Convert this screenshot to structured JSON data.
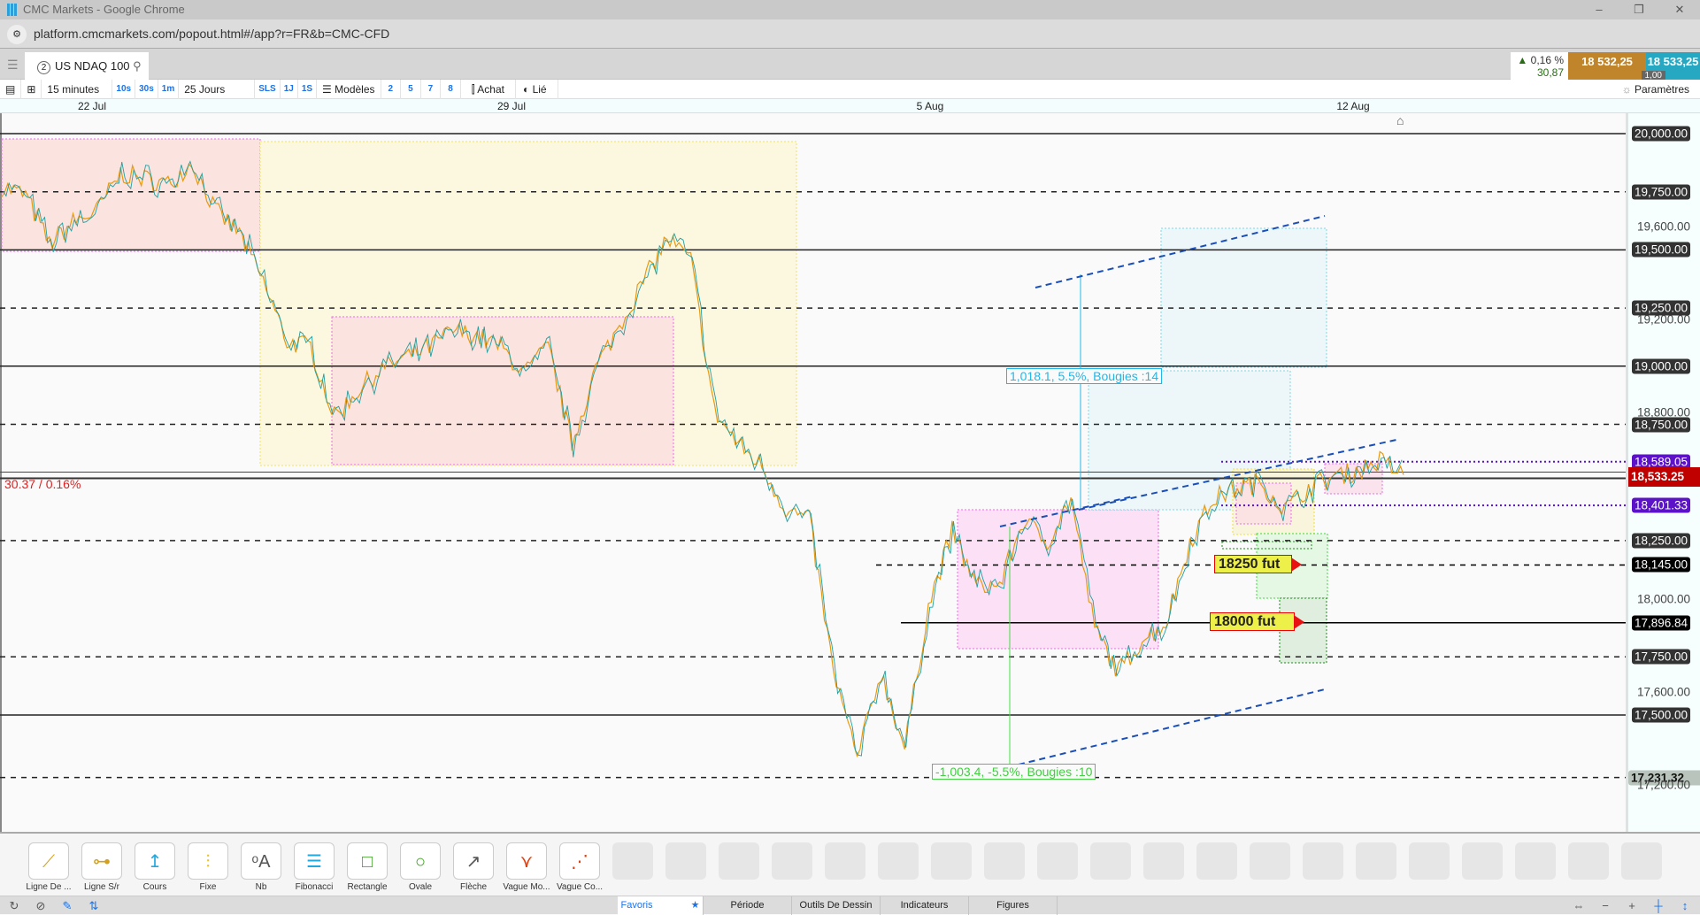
{
  "window": {
    "title": "CMC Markets - Google Chrome",
    "url": "platform.cmcmarkets.com/popout.html#/app?r=FR&b=CMC-CFD"
  },
  "tab": {
    "index": "2",
    "instrument": "US NDAQ 100"
  },
  "quote": {
    "change_pct": "0,16 %",
    "change_abs": "30,87",
    "sell": "18 532,25",
    "buy": "18 533,25",
    "spread": "1,00"
  },
  "toolbar": {
    "interval": "15 minutes",
    "quick": [
      "10s",
      "30s",
      "1m"
    ],
    "range": "25 Jours",
    "periods": [
      "SLS",
      "1J",
      "1S"
    ],
    "models": "Modèles",
    "counts": [
      "2",
      "5",
      "7",
      "8"
    ],
    "chart_type": "Achat",
    "linked": "Lié",
    "settings": "Paramètres"
  },
  "annotations": {
    "up_measure": "1,018.1, 5.5%, Bougies :14",
    "down_measure": "-1,003.4, -5.5%, Bougies :10",
    "change_label": "30.37 / 0.16%",
    "fut1": "18250 fut",
    "fut2": "18000 fut"
  },
  "chart_data": {
    "type": "line",
    "instrument": "US NDAQ 100",
    "x_ticks": [
      "22 Jul",
      "29 Jul",
      "5 Aug",
      "12 Aug"
    ],
    "ylim": [
      17150,
      20100
    ],
    "y_ticks": [
      19600,
      19200,
      18800,
      18000,
      17600,
      17200
    ],
    "y_ticks_text": [
      "19,600.00",
      "19,200.00",
      "18,800.00",
      "18,000.00",
      "17,600.00",
      "17,200.00"
    ],
    "series": [
      {
        "values": [
          19773,
          19736,
          19526,
          19619,
          19666,
          19829,
          19806,
          19782,
          19875,
          19666,
          19573,
          19363,
          19106,
          19083,
          18780,
          18897,
          18990,
          19036,
          19083,
          19153,
          19130,
          19083,
          18967,
          19083,
          18664,
          18990,
          19176,
          19363,
          19549,
          19456,
          18803,
          18664,
          18570,
          18384,
          18337,
          17685,
          17312,
          17685,
          17359,
          17965,
          18291,
          18058,
          18058,
          18337,
          18244,
          18431,
          17871,
          17685,
          17825,
          17895,
          18244,
          18431,
          18477,
          18500,
          18384,
          18477,
          18524,
          18547,
          18594,
          18533
        ]
      }
    ],
    "levels": [
      {
        "price": 20000,
        "label": "20,000.00",
        "style": "solid"
      },
      {
        "price": 19750,
        "label": "19,750.00",
        "style": "dashed"
      },
      {
        "price": 19500,
        "label": "19,500.00",
        "style": "solid"
      },
      {
        "price": 19250,
        "label": "19,250.00",
        "style": "dashed"
      },
      {
        "price": 19000,
        "label": "19,000.00",
        "style": "solid"
      },
      {
        "price": 18750,
        "label": "18,750.00",
        "style": "dashed"
      },
      {
        "price": 18589.05,
        "label": "18,589.05",
        "style": "dotted-purple"
      },
      {
        "price": 18401.33,
        "label": "18,401.33",
        "style": "dotted-purple"
      },
      {
        "price": 18250,
        "label": "18,250.00",
        "style": "dashed"
      },
      {
        "price": 18145,
        "label": "18,145.00",
        "style": "dashed-partial"
      },
      {
        "price": 17896.84,
        "label": "17,896.84",
        "style": "solid-partial"
      },
      {
        "price": 17750,
        "label": "17,750.00",
        "style": "dashed"
      },
      {
        "price": 17500,
        "label": "17,500.00",
        "style": "solid"
      },
      {
        "price": 17231.32,
        "label": "17,231.32",
        "style": "dashed"
      }
    ],
    "last_price": {
      "price": 18533.25,
      "label": "18,533.25",
      "color": "#c00000"
    }
  },
  "drawing_tools": [
    "Ligne De ...",
    "Ligne S/r",
    "Cours",
    "Fixe",
    "Nb",
    "Fibonacci",
    "Rectangle",
    "Ovale",
    "Flèche",
    "Vague Mo...",
    "Vague Co..."
  ],
  "bottom_tabs": [
    "Favoris",
    "Période",
    "Outils De Dessin",
    "Indicateurs",
    "Figures"
  ],
  "colors": {
    "sell": "#c0842a",
    "buy": "#27a8c2",
    "up": "#2a6b18",
    "last": "#c00000",
    "purple": "#5b12c8"
  }
}
